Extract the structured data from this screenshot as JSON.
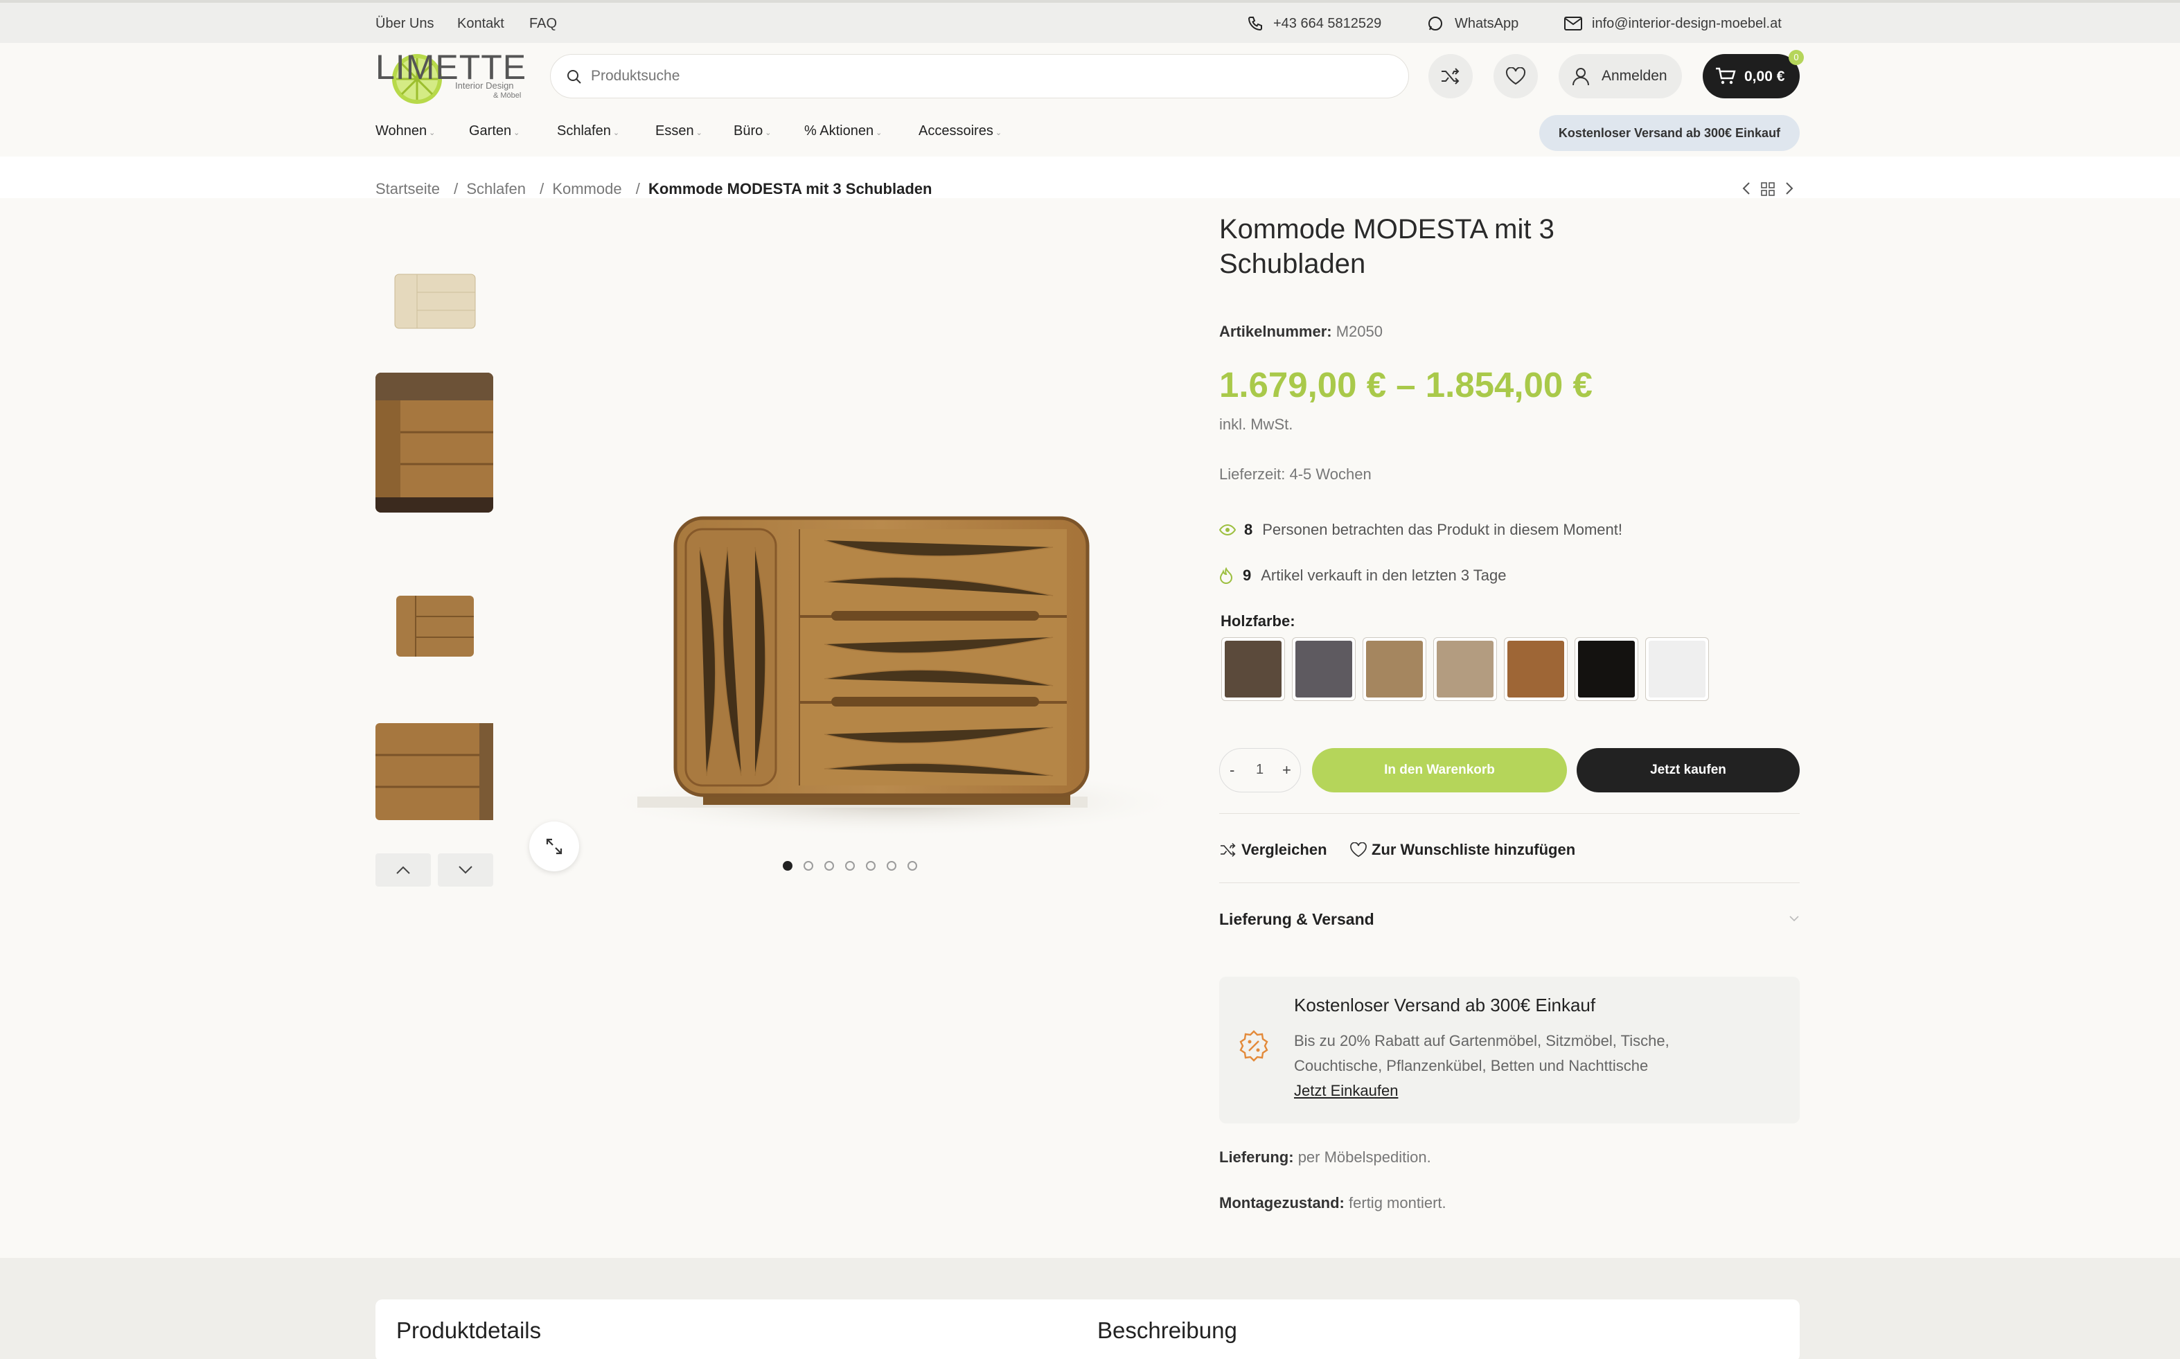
{
  "topbar": {
    "links": [
      "Über Uns",
      "Kontakt",
      "FAQ"
    ],
    "phone": "+43 664 5812529",
    "whatsapp": "WhatsApp",
    "email": "info@interior-design-moebel.at"
  },
  "brand": {
    "logo_text": "LIMETTE",
    "logo_sub1": "Interior Design",
    "logo_sub2": "& Möbel"
  },
  "search": {
    "placeholder": "Produktsuche"
  },
  "account": {
    "login_label": "Anmelden"
  },
  "cart": {
    "total": "0,00 €",
    "count": "0"
  },
  "nav": {
    "items": [
      "Wohnen",
      "Garten",
      "Schlafen",
      "Essen",
      "Büro",
      "% Aktionen",
      "Accessoires"
    ],
    "shipping_badge": "Kostenloser Versand ab 300€ Einkauf"
  },
  "breadcrumb": {
    "items": [
      "Startseite",
      "Schlafen",
      "Kommode"
    ],
    "current": "Kommode MODESTA mit 3 Schubladen",
    "separator": "/"
  },
  "gallery": {
    "dots": 7,
    "active_dot": 1
  },
  "product": {
    "title_line1": "Kommode MODESTA mit 3",
    "title_line2": "Schubladen",
    "sku_label": "Artikelnummer:",
    "sku": "M2050",
    "price": "1.679,00 € – 1.854,00 €",
    "tax_note": "inkl. MwSt.",
    "delivery_time": "Lieferzeit: 4-5 Wochen",
    "viewers_count": "8",
    "viewers_text": "Personen betrachten das Produkt in diesem Moment!",
    "sold_count": "9",
    "sold_text": "Artikel verkauft in den letzten 3 Tage",
    "wood_label": "Holzfarbe",
    "swatch_colors": [
      "#5b4a3b",
      "#5e5a60",
      "#a5865f",
      "#b39c80",
      "#9e6636",
      "#141210",
      "#efefef"
    ],
    "quantity": "1",
    "qty_minus": "-",
    "qty_plus": "+",
    "add_to_cart": "In den Warenkorb",
    "buy_now": "Jetzt kaufen",
    "compare": "Vergleichen",
    "wishlist": "Zur Wunschliste hinzufügen",
    "accordion_title": "Lieferung & Versand",
    "promo_title": "Kostenloser Versand ab 300€ Einkauf",
    "promo_text1": "Bis zu 20% Rabatt auf Gartenmöbel, Sitzmöbel, Tische,",
    "promo_text2": "Couchtische, Pflanzenkübel, Betten und Nachttische",
    "promo_link": "Jetzt Einkaufen",
    "delivery_label": "Lieferung:",
    "delivery_value": "per Möbelspedition.",
    "assembly_label": "Montagezustand:",
    "assembly_value": "fertig montiert."
  },
  "tabs": {
    "details": "Produktdetails",
    "description": "Beschreibung"
  },
  "colors": {
    "accent": "#b5d55a",
    "price": "#a9c94a",
    "dark": "#1e1e1e"
  }
}
